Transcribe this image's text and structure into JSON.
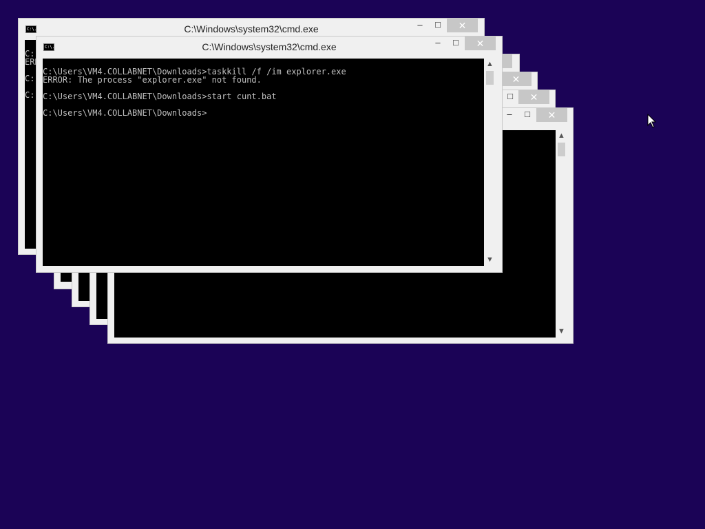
{
  "icons": {
    "window": "cmd-icon",
    "minimize": "minimize-icon",
    "maximize": "maximize-icon",
    "close": "close-icon",
    "scroll_up": "scroll-up-arrow-icon",
    "scroll_down": "scroll-down-arrow-icon",
    "cursor": "mouse-pointer-icon"
  },
  "colors": {
    "desktop": "#1b0356",
    "console_bg": "#000000",
    "console_text": "#c0c0c0",
    "close_button": "#c7c7c7"
  },
  "controls": {
    "minimize": "–",
    "maximize": "□",
    "close": "✕"
  },
  "icon_glyph": "C:\\.",
  "scroll": {
    "up": "▲",
    "down": "▼"
  },
  "windows": {
    "back": {
      "title": "C:\\Windows\\system32\\cmd.exe",
      "console_peek": "C:\nERR\n\nC:\n\nC:"
    },
    "front": {
      "title": "C:\\Windows\\system32\\cmd.exe",
      "console_text": "C:\\Users\\VM4.COLLABNET\\Downloads>taskkill /f /im explorer.exe\nERROR: The process \"explorer.exe\" not found.\n\nC:\\Users\\VM4.COLLABNET\\Downloads>start cunt.bat\n\nC:\\Users\\VM4.COLLABNET\\Downloads>"
    }
  }
}
